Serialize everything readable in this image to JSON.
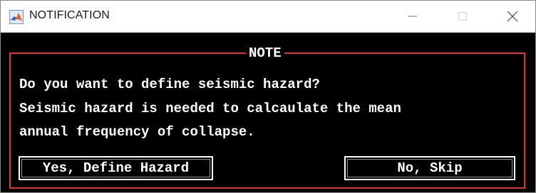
{
  "window": {
    "title": "NOTIFICATION",
    "icons": [
      "matlab-icon",
      "minimize-icon",
      "maximize-icon",
      "close-icon"
    ]
  },
  "dialog": {
    "frame_title": "NOTE",
    "message_lines": [
      "Do you want to define seismic hazard?",
      "Seismic hazard is needed to calcaulate the mean",
      "annual frequency of collapse."
    ],
    "buttons": {
      "yes_label": "Yes, Define Hazard",
      "no_label": "No, Skip"
    }
  },
  "colors": {
    "background": "#000000",
    "frame_border": "#e1343a",
    "text": "#ffffff"
  }
}
